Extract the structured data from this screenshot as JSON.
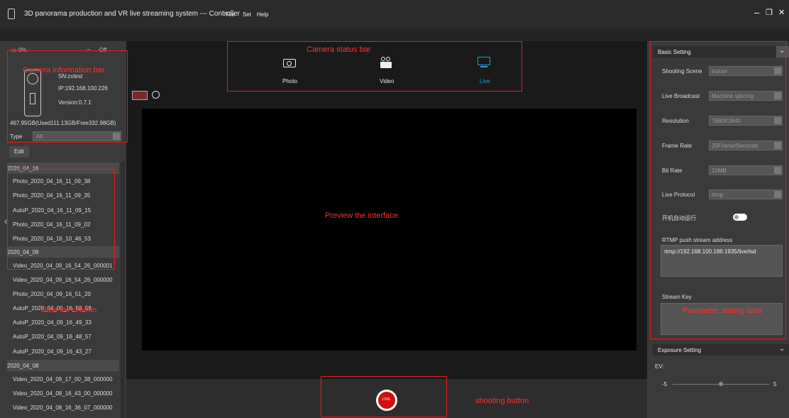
{
  "window": {
    "title": "3D panorama production and VR live streaming system --- Controller",
    "menu": [
      "File",
      "Set",
      "Help"
    ],
    "controls": [
      "minimize",
      "restore",
      "close"
    ]
  },
  "camera_info": {
    "battery": "0%",
    "wifi": "Off",
    "sn": "SN:zxtest",
    "ip": "IP:192.168.100.226",
    "version": "Version:0.7.1",
    "storage": "467.95GB(Used111.13GB/Free332.98GB)",
    "type_label": "Type",
    "type_value": "All",
    "edit_label": "Edit"
  },
  "file_groups": [
    {
      "date": "2020_04_16",
      "files": [
        "Photo_2020_04_16_11_09_38",
        "Photo_2020_04_16_11_09_35",
        "AutoP_2020_04_16_11_09_15",
        "Photo_2020_04_16_11_09_02",
        "Photo_2020_04_16_10_46_53"
      ]
    },
    {
      "date": "2020_04_09",
      "files": [
        "Video_2020_04_09_16_54_26_000001",
        "Video_2020_04_09_16_54_26_000000",
        "Photo_2020_04_09_16_51_20",
        "AutoP_2020_04_09_16_50_58",
        "AutoP_2020_04_09_16_49_33",
        "AutoP_2020_04_09_16_48_57",
        "AutoP_2020_04_09_16_43_27"
      ]
    },
    {
      "date": "2020_04_08",
      "files": [
        "Video_2020_04_08_17_00_38_000000",
        "Video_2020_04_08_16_43_00_000000",
        "Video_2020_04_08_16_36_07_000000"
      ]
    }
  ],
  "modes": [
    {
      "label": "Photo",
      "icon": "camera-icon",
      "active": false
    },
    {
      "label": "Video",
      "icon": "video-camera-icon",
      "active": false
    },
    {
      "label": "Live",
      "icon": "live-screen-icon",
      "active": true
    }
  ],
  "shoot_button_label": "LIVE",
  "annotations": {
    "camera_info": "Camera information bar",
    "camera_status": "Camera status bar",
    "preview": "Preview the interface",
    "data_list": "Data list column",
    "param": "Parameter setting area",
    "shooting": "shooting button"
  },
  "basic_setting": {
    "header": "Basic Setting",
    "fields": [
      {
        "label": "Shooting Scene",
        "value": "indoor"
      },
      {
        "label": "Live Broadcast",
        "value": "Machine splicing"
      },
      {
        "label": "Resolution",
        "value": "7680X3840"
      },
      {
        "label": "Frame Rate",
        "value": "20Frame/Seconds"
      },
      {
        "label": "Bit Rate",
        "value": "10MB"
      },
      {
        "label": "Live Protocol",
        "value": "rtmp"
      }
    ],
    "autostart_label": "开机自动运行",
    "rtmp_label": "RTMP push stream address",
    "rtmp_value": "rtmp://192.168.100.186:1935/live/lsd",
    "stream_key_label": "Stream Key",
    "stream_key_value": ""
  },
  "exposure": {
    "header": "Exposure Setting",
    "ev_label": "EV:",
    "min": "-5",
    "max": "5",
    "value": 0
  },
  "colors": {
    "accent": "#1aa3e0",
    "annotation": "#e02020",
    "live_red": "#d01010"
  }
}
